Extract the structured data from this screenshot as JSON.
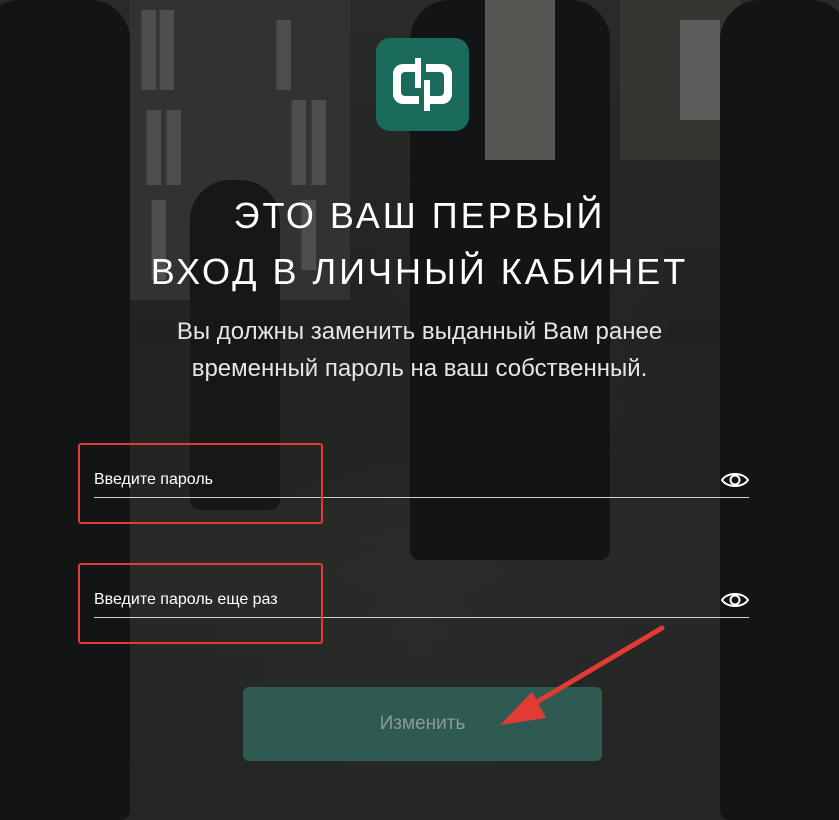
{
  "logo": {
    "icon": "company-logo",
    "color": "#1a6b5b"
  },
  "title": {
    "line1": "ЭТО ВАШ ПЕРВЫЙ",
    "line2": "ВХОД В ЛИЧНЫЙ КАБИНЕТ"
  },
  "subtitle": {
    "line1": "Вы должны заменить выданный Вам ранее",
    "line2": "временный пароль на ваш собственный."
  },
  "form": {
    "password": {
      "placeholder": "Введите пароль",
      "value": "",
      "icon": "eye-icon"
    },
    "password_repeat": {
      "placeholder": "Введите пароль еще раз",
      "value": "",
      "icon": "eye-icon"
    },
    "submit_label": "Изменить"
  },
  "annotations": {
    "highlight_color": "#e23b33",
    "arrow_color": "#e23b33"
  }
}
